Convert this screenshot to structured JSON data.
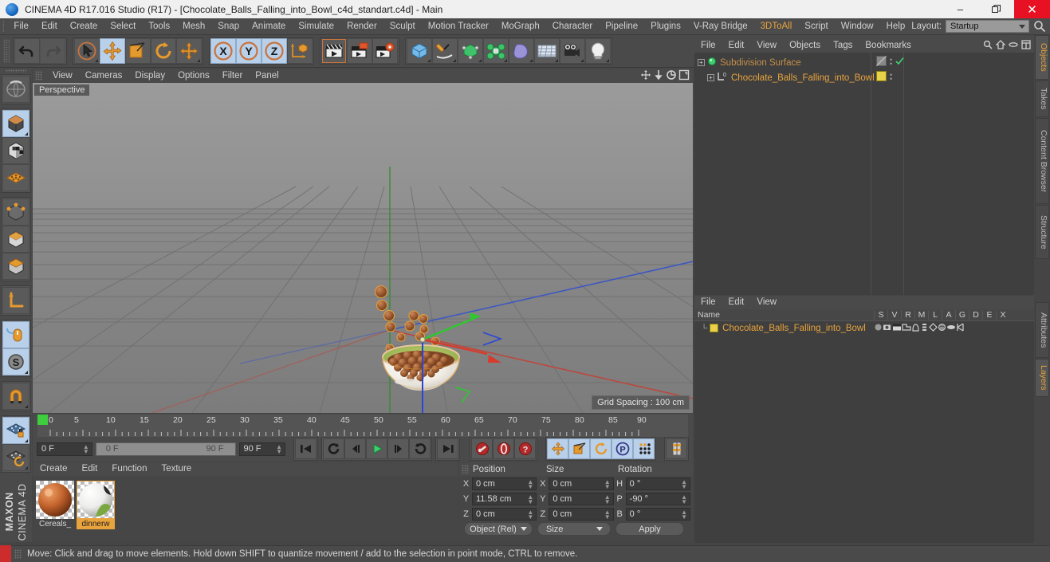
{
  "window": {
    "title": "CINEMA 4D R17.016 Studio (R17) - [Chocolate_Balls_Falling_into_Bowl_c4d_standart.c4d] - Main",
    "minimize": "–",
    "restore": "❐",
    "close": "✕"
  },
  "menubar": {
    "items": [
      "File",
      "Edit",
      "Create",
      "Select",
      "Tools",
      "Mesh",
      "Snap",
      "Animate",
      "Simulate",
      "Render",
      "Sculpt",
      "Motion Tracker",
      "MoGraph",
      "Character",
      "Pipeline",
      "Plugins",
      "V-Ray Bridge",
      "3DToAll",
      "Script",
      "Window",
      "Help"
    ],
    "layout_label": "Layout:",
    "layout_value": "Startup",
    "search_icon": "search-icon"
  },
  "toolbar": {
    "undo": "undo-icon",
    "redo": "redo-icon",
    "select": "live-selection-icon",
    "move": "move-tool-icon",
    "scale": "scale-tool-icon",
    "rotate": "rotate-tool-icon",
    "move2": "move-axis-icon",
    "axis_x": "X",
    "axis_y": "Y",
    "axis_z": "Z",
    "world_object": "world-object-axis-icon",
    "render_view": "render-view-icon",
    "render_region": "render-region-icon",
    "render_settings": "render-settings-icon",
    "cube": "primitive-cube-icon",
    "spline": "spline-pen-icon",
    "nurbs": "generator-nurbs-icon",
    "array": "modeling-object-icon",
    "deformer": "deformer-bend-icon",
    "scene": "scene-environment-icon",
    "camera": "camera-icon",
    "light": "light-icon"
  },
  "lefttool": {
    "items": [
      {
        "name": "undo-view-icon",
        "sel": false
      },
      {
        "name": "model-mode-icon",
        "sel": true
      },
      {
        "name": "texture-mode-icon",
        "sel": false
      },
      {
        "name": "polygon-mode-icon",
        "sel": false
      },
      {
        "name": "points-mode-icon",
        "sel": false
      },
      {
        "name": "edges-mode-icon",
        "sel": false
      },
      {
        "name": "polygons-mode-icon",
        "sel": false
      },
      {
        "name": "axis-mode-icon",
        "sel": false
      },
      {
        "name": "enable-axis-icon",
        "sel": true
      },
      {
        "name": "soft-selection-icon",
        "sel": true
      },
      {
        "name": "magnet-icon",
        "sel": false
      },
      {
        "name": "lock-workplane-icon",
        "sel": true
      },
      {
        "name": "workplane-icon",
        "sel": false
      }
    ],
    "brand_line1": "MAXON",
    "brand_line2": "CINEMA 4D"
  },
  "viewport": {
    "menus": [
      "View",
      "Cameras",
      "Display",
      "Options",
      "Filter",
      "Panel"
    ],
    "nav_icons": [
      "pan-icon",
      "dolly-icon",
      "rotate-icon",
      "maximize-view-icon"
    ],
    "perspective_label": "Perspective",
    "grid_spacing": "Grid Spacing : 100 cm"
  },
  "timeline": {
    "ticks": [
      "0",
      "5",
      "10",
      "15",
      "20",
      "25",
      "30",
      "35",
      "40",
      "45",
      "50",
      "55",
      "60",
      "65",
      "70",
      "75",
      "80",
      "85",
      "90"
    ],
    "current_frame": "0 F",
    "range_start": "0 F",
    "range_end": "90 F",
    "end_frame": "90 F",
    "preview_frame": "0 F",
    "buttons": [
      {
        "name": "go-to-start-button",
        "glyph": "goto-start-icon"
      },
      {
        "name": "play-backwards-button",
        "glyph": "loop-icon"
      },
      {
        "name": "previous-frame-button",
        "glyph": "prev-frame-icon"
      },
      {
        "name": "play-button",
        "glyph": "play-icon"
      },
      {
        "name": "next-frame-button",
        "glyph": "next-frame-icon"
      },
      {
        "name": "loop-button",
        "glyph": "loop-back-icon"
      },
      {
        "name": "go-to-end-button",
        "glyph": "goto-end-icon"
      }
    ],
    "record_buttons": [
      "record-keyframe-icon",
      "autokey-icon",
      "keyframe-selection-icon"
    ],
    "key_toggles": [
      "position-key-icon",
      "scale-key-icon",
      "rotation-key-icon",
      "param-key-icon",
      "point-level-anim-icon"
    ],
    "timeline_toggle": "timeline-view-icon"
  },
  "materials": {
    "menus": [
      "Create",
      "Edit",
      "Function",
      "Texture"
    ],
    "items": [
      {
        "name": "Cereals_",
        "selected": false,
        "color": "#c2632c"
      },
      {
        "name": "dinnerw",
        "selected": true,
        "color": "#e8e8e0"
      }
    ]
  },
  "coordinates": {
    "title_position": "Position",
    "title_size": "Size",
    "title_rotation": "Rotation",
    "rows": [
      {
        "l1": "X",
        "v1": "0 cm",
        "l2": "X",
        "v2": "0 cm",
        "l3": "H",
        "v3": "0 °"
      },
      {
        "l1": "Y",
        "v1": "11.58 cm",
        "l2": "Y",
        "v2": "0 cm",
        "l3": "P",
        "v3": "-90 °"
      },
      {
        "l1": "Z",
        "v1": "0 cm",
        "l2": "Z",
        "v2": "0 cm",
        "l3": "B",
        "v3": "0 °"
      }
    ],
    "mode_dropdown": "Object (Rel)",
    "size_dropdown": "Size",
    "apply_button": "Apply"
  },
  "object_manager": {
    "menus": [
      "File",
      "Edit",
      "View",
      "Objects",
      "Tags",
      "Bookmarks"
    ],
    "header_icons": [
      "search-icon",
      "home-icon",
      "link-icon",
      "fit-icon"
    ],
    "rows": [
      {
        "label": "Subdivision Surface",
        "indent": 0,
        "icon": "subdivision-surface-icon",
        "tag": "phong-tag-icon",
        "check": "visible-check-icon"
      },
      {
        "label": "Chocolate_Balls_Falling_into_Bowl",
        "indent": 1,
        "icon": "null-object-icon",
        "tag": "material-tag-icon",
        "check": ""
      }
    ]
  },
  "layer_manager": {
    "menus": [
      "File",
      "Edit",
      "View"
    ],
    "columns": [
      "Name",
      "S",
      "V",
      "R",
      "M",
      "L",
      "A",
      "G",
      "D",
      "E",
      "X"
    ],
    "rows": [
      {
        "name": "Chocolate_Balls_Falling_into_Bowl",
        "swatch": "#e8d24a"
      }
    ]
  },
  "right_tabs": {
    "upper": [
      "Objects",
      "Takes",
      "Content Browser",
      "Structure"
    ],
    "lower": [
      "Attributes",
      "Layers"
    ],
    "active_upper": "Objects",
    "active_lower": "Layers"
  },
  "statusbar": {
    "text": "Move: Click and drag to move elements. Hold down SHIFT to quantize movement / add to the selection in point mode, CTRL to remove."
  },
  "colors": {
    "accent_orange": "#e8a33d",
    "selection_blue": "#b9d0ea",
    "axis_x": "#d83a2c",
    "axis_y": "#3ec83e",
    "axis_z": "#3a4fd8",
    "panel_bg": "#4a4a4a"
  }
}
